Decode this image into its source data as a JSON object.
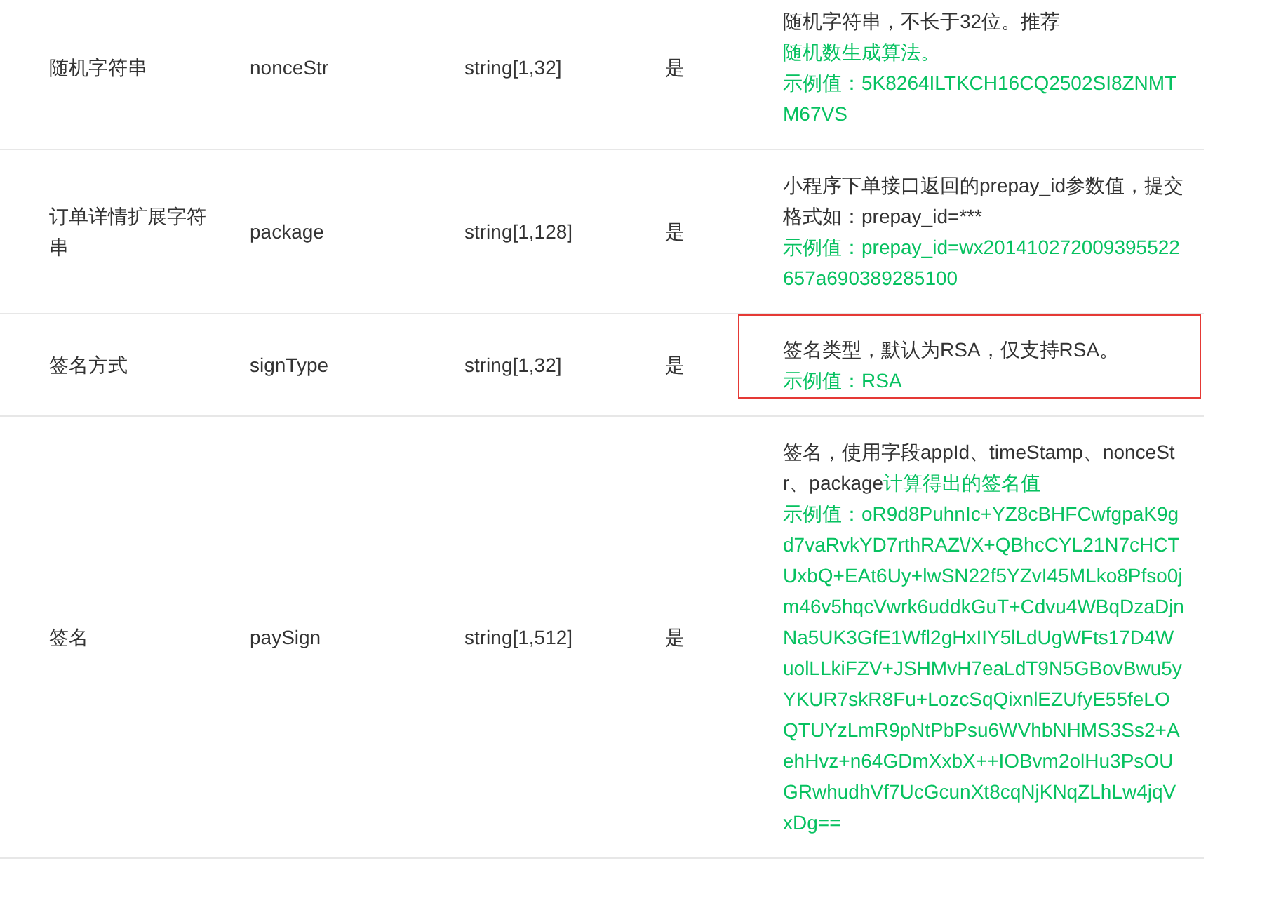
{
  "rows": [
    {
      "name": "随机字符串",
      "field": "nonceStr",
      "type": "string[1,32]",
      "required": "是",
      "highlighted": false,
      "description": [
        {
          "kind": "text",
          "text": "随机字符串，不长于32位。推荐"
        },
        {
          "kind": "link",
          "text": "随机数生成算法。"
        }
      ],
      "example": "示例值：5K8264ILTKCH16CQ2502SI8ZNMTM67VS"
    },
    {
      "name": "订单详情扩展字符串",
      "field": "package",
      "type": "string[1,128]",
      "required": "是",
      "highlighted": false,
      "description": [
        {
          "kind": "text",
          "text": "小程序下单接口返回的prepay_id参数值，提交格式如：prepay_id=***"
        }
      ],
      "example": "示例值：prepay_id=wx201410272009395522657a690389285100"
    },
    {
      "name": "签名方式",
      "field": "signType",
      "type": "string[1,32]",
      "required": "是",
      "highlighted": true,
      "description": [
        {
          "kind": "text",
          "text": "签名类型，默认为RSA，仅支持RSA。"
        }
      ],
      "example": "示例值：RSA"
    },
    {
      "name": "签名",
      "field": "paySign",
      "type": "string[1,512]",
      "required": "是",
      "highlighted": false,
      "description": [
        {
          "kind": "text",
          "text": "签名，使用字段appId、timeStamp、nonceStr、package"
        },
        {
          "kind": "link",
          "text": "计算得出的签名值"
        }
      ],
      "example": "示例值：oR9d8PuhnIc+YZ8cBHFCwfgpaK9gd7vaRvkYD7rthRAZ\\/X+QBhcCYL21N7cHCTUxbQ+EAt6Uy+lwSN22f5YZvI45MLko8Pfso0jm46v5hqcVwrk6uddkGuT+Cdvu4WBqDzaDjnNa5UK3GfE1Wfl2gHxIIY5lLdUgWFts17D4WuolLLkiFZV+JSHMvH7eaLdT9N5GBovBwu5yYKUR7skR8Fu+LozcSqQixnlEZUfyE55feLOQTUYzLmR9pNtPbPsu6WVhbNHMS3Ss2+AehHvz+n64GDmXxbX++IOBvm2olHu3PsOUGRwhudhVf7UcGcunXt8cqNjKNqZLhLw4jqVxDg=="
    }
  ]
}
